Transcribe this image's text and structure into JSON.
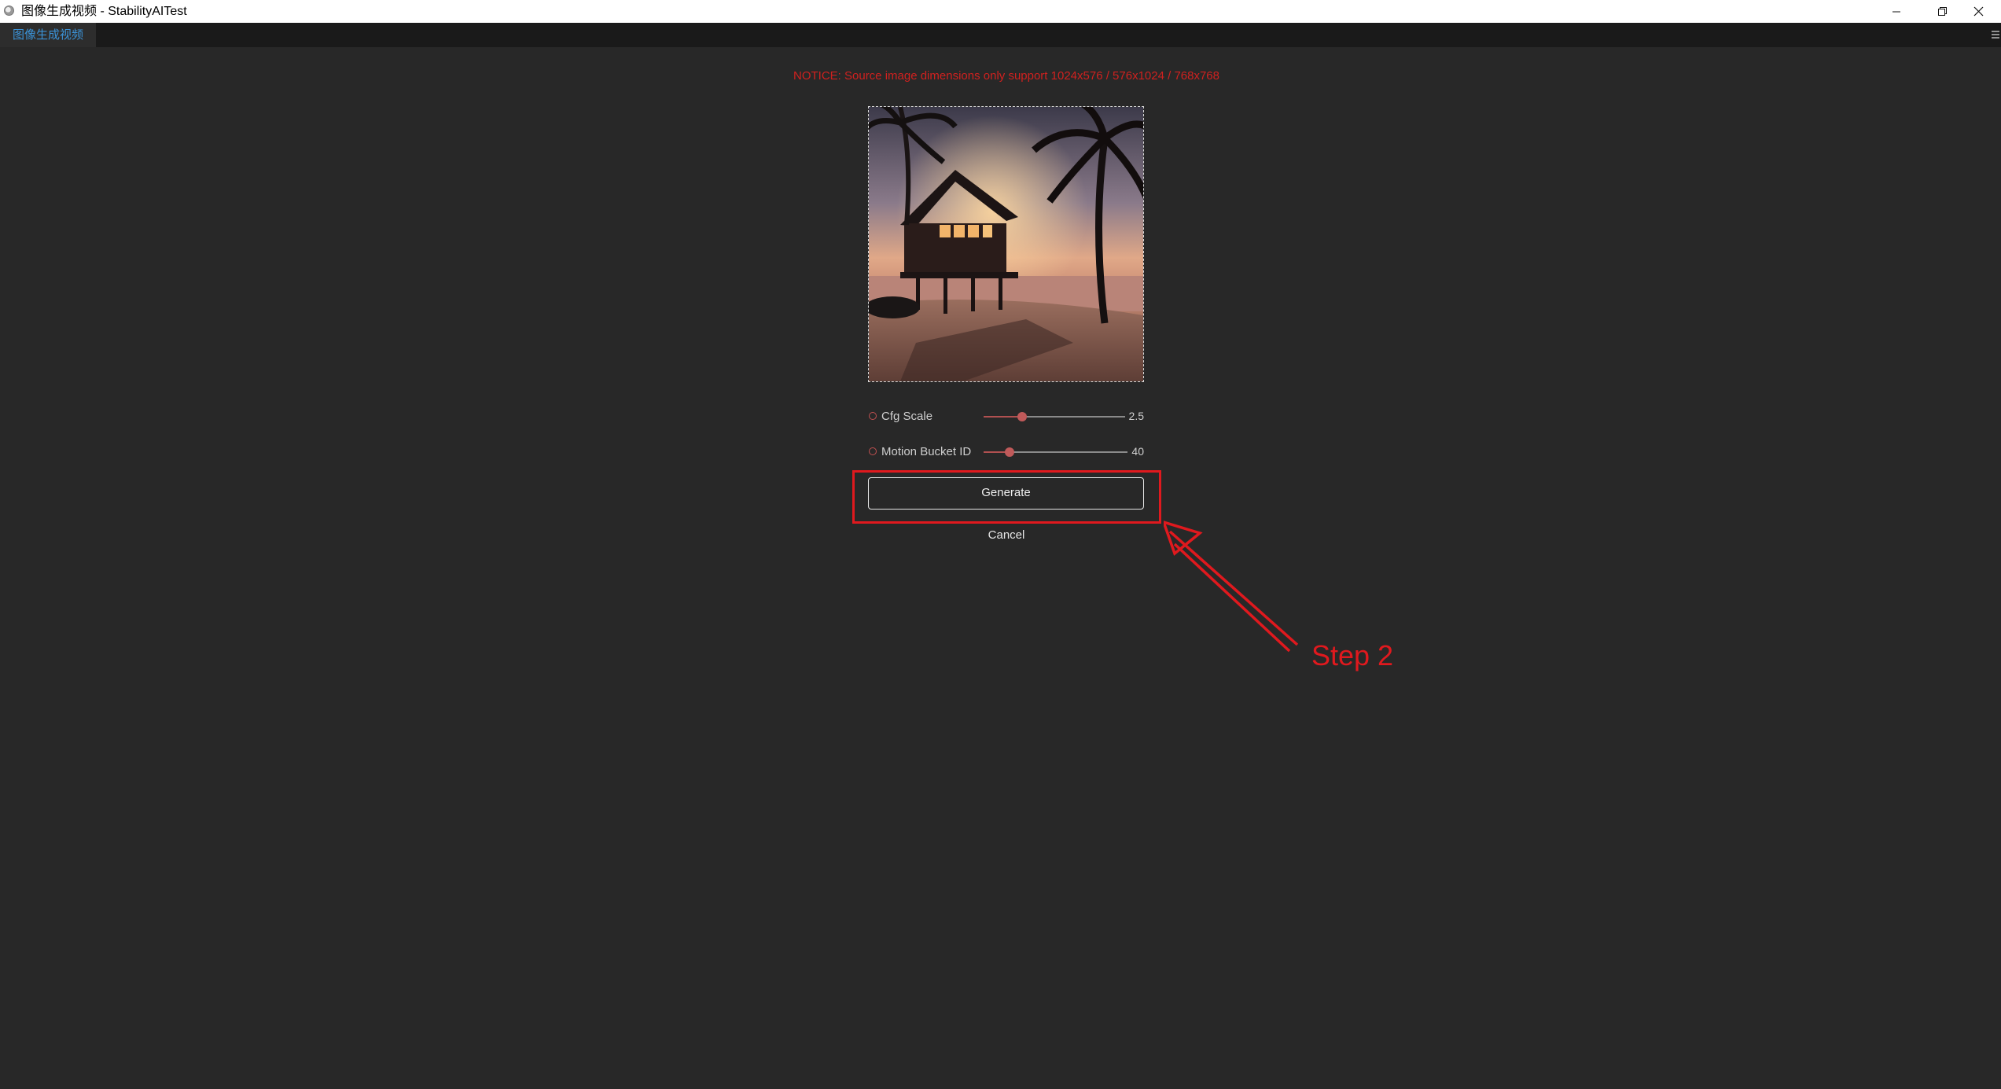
{
  "window": {
    "title": "图像生成视频 - StabilityAITest",
    "controls": {
      "minimize": "minimize-icon",
      "restore": "restore-icon",
      "close": "close-icon"
    }
  },
  "tabs": [
    {
      "label": "图像生成视频",
      "active": true
    }
  ],
  "notice": "NOTICE: Source image dimensions only support 1024x576 / 576x1024 / 768x768",
  "source_image": {
    "description_icon": "image-preview"
  },
  "params": [
    {
      "label": "Cfg Scale",
      "value": "2.5",
      "level": 0.27
    },
    {
      "label": "Motion Bucket ID",
      "value": "40",
      "level": 0.18
    }
  ],
  "actions": {
    "generate": "Generate",
    "cancel": "Cancel"
  },
  "annotation": {
    "step": "Step 2",
    "color": "#e0191e"
  },
  "colors": {
    "background": "#282828",
    "accent": "#c05a5a",
    "notice": "#d0211f",
    "tab_text": "#3b93d8"
  }
}
